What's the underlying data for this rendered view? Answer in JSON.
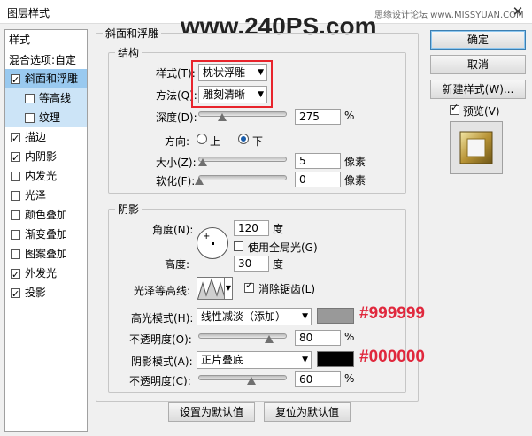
{
  "window": {
    "title": "图层样式",
    "close_symbol": "✕"
  },
  "watermark": {
    "text": "www.240PS.com",
    "site_credit": "思缘设计论坛  www.MISSYUAN.COM"
  },
  "sidebar": {
    "header": "样式",
    "blend_options": "混合选项:自定",
    "items": [
      {
        "label": "斜面和浮雕",
        "checked": true,
        "selected": true,
        "sub": false
      },
      {
        "label": "等高线",
        "checked": false,
        "selected": false,
        "sub": true
      },
      {
        "label": "纹理",
        "checked": false,
        "selected": false,
        "sub": true
      },
      {
        "label": "描边",
        "checked": true,
        "selected": false,
        "sub": false
      },
      {
        "label": "内阴影",
        "checked": true,
        "selected": false,
        "sub": false
      },
      {
        "label": "内发光",
        "checked": false,
        "selected": false,
        "sub": false
      },
      {
        "label": "光泽",
        "checked": false,
        "selected": false,
        "sub": false
      },
      {
        "label": "颜色叠加",
        "checked": false,
        "selected": false,
        "sub": false
      },
      {
        "label": "渐变叠加",
        "checked": false,
        "selected": false,
        "sub": false
      },
      {
        "label": "图案叠加",
        "checked": false,
        "selected": false,
        "sub": false
      },
      {
        "label": "外发光",
        "checked": true,
        "selected": false,
        "sub": false
      },
      {
        "label": "投影",
        "checked": true,
        "selected": false,
        "sub": false
      }
    ]
  },
  "bevel": {
    "section_title": "斜面和浮雕",
    "structure_title": "结构",
    "style_label": "样式(T):",
    "style_value": "枕状浮雕",
    "technique_label": "方法(Q):",
    "technique_value": "雕刻清晰",
    "depth_label": "深度(D):",
    "depth_value": "275",
    "depth_unit": "%",
    "depth_pct": 0.27,
    "direction_label": "方向:",
    "dir_up": "上",
    "dir_down": "下",
    "direction_selected": "下",
    "size_label": "大小(Z):",
    "size_value": "5",
    "size_unit": "像素",
    "soften_label": "软化(F):",
    "soften_value": "0",
    "soften_unit": "像素"
  },
  "shading": {
    "title": "阴影",
    "angle_label": "角度(N):",
    "angle_value": "120",
    "angle_unit": "度",
    "global_light_label": "使用全局光(G)",
    "global_light": false,
    "altitude_label": "高度:",
    "altitude_value": "30",
    "altitude_unit": "度",
    "gloss_contour_label": "光泽等高线:",
    "anti_alias_label": "消除锯齿(L)",
    "anti_alias": true,
    "highlight_mode_label": "高光模式(H):",
    "highlight_mode": "线性减淡（添加）",
    "highlight_color": "#999999",
    "highlight_color_label": "#999999",
    "highlight_opacity_label": "不透明度(O):",
    "highlight_opacity": "80",
    "opacity_unit": "%",
    "shadow_mode_label": "阴影模式(A):",
    "shadow_mode": "正片叠底",
    "shadow_color": "#000000",
    "shadow_color_label": "#000000",
    "shadow_opacity_label": "不透明度(C):",
    "shadow_opacity": "60"
  },
  "footer": {
    "make_default": "设置为默认值",
    "reset_default": "复位为默认值"
  },
  "buttons": {
    "ok": "确定",
    "cancel": "取消",
    "new_style": "新建样式(W)...",
    "preview_label": "预览(V)",
    "preview_checked": true
  }
}
